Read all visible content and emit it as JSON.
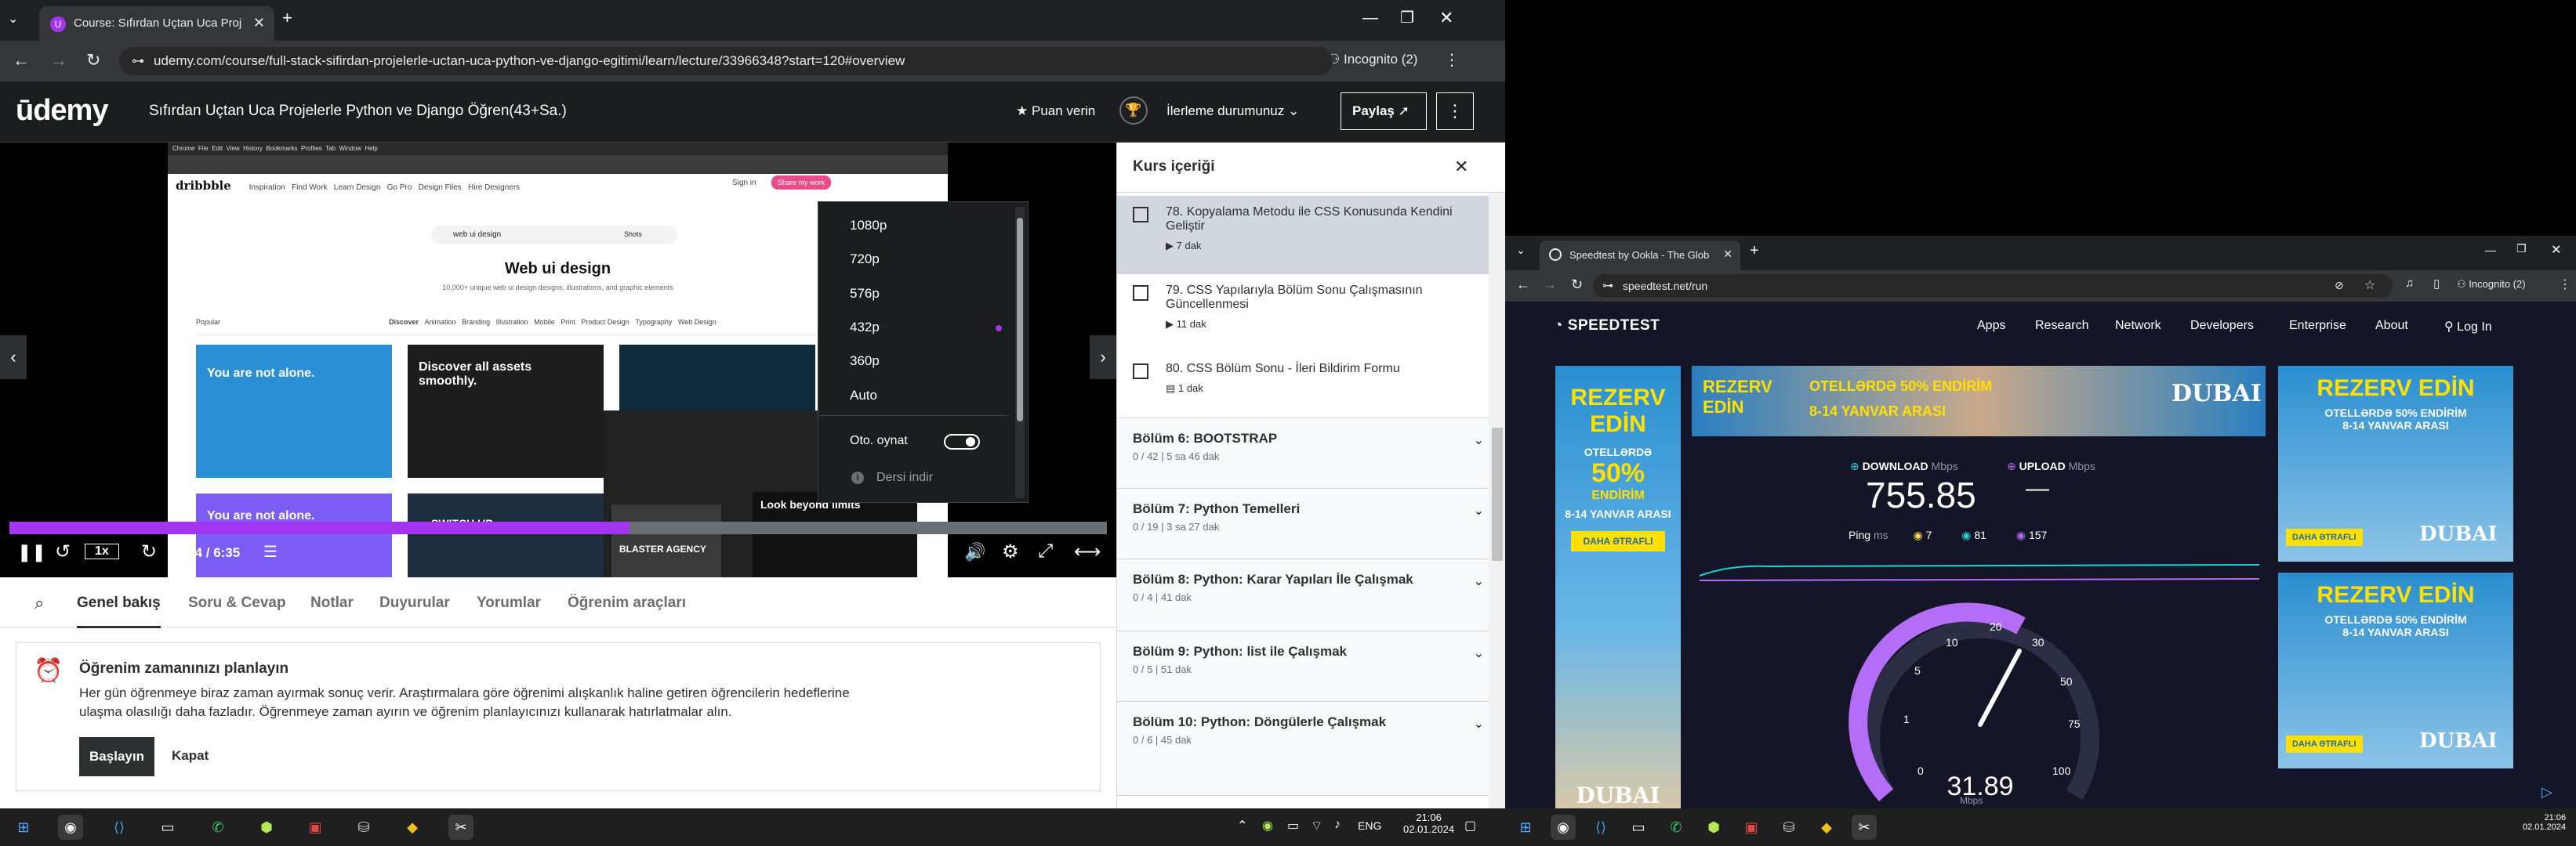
{
  "left_browser": {
    "tab_title": "Course: Sıfırdan Uçtan Uca Proj",
    "new_tab": "+",
    "url": "udemy.com/course/full-stack-sifirdan-projelerle-uctan-uca-python-ve-django-egitimi/learn/lecture/33966348?start=120#overview",
    "profile": "Incognito (2)"
  },
  "udemy_header": {
    "logo": "ūdemy",
    "course_title": "Sıfırdan Uçtan Uca Projelerle Python ve Django Öğren(43+Sa.)",
    "rate": "Puan verin",
    "progress": "İlerleme durumunuz",
    "share": "Paylaş"
  },
  "video_content": {
    "browser_menu": [
      "Chrome",
      "File",
      "Edit",
      "View",
      "History",
      "Bookmarks",
      "Profiles",
      "Tab",
      "Window",
      "Help"
    ],
    "site_logo": "dribbble",
    "site_nav": [
      "Inspiration",
      "Find Work",
      "Learn Design",
      "Go Pro",
      "Design Files",
      "Hire Designers"
    ],
    "sign_in": "Sign in",
    "share_work": "Share my work",
    "search_value": "web ui design",
    "search_scope": "Shots",
    "heading": "Web ui design",
    "subheading": "10,000+ unique web ui design designs, illustrations, and graphic elements",
    "filter_left": "Popular",
    "filter_tabs": [
      "Discover",
      "Animation",
      "Branding",
      "Illustration",
      "Mobile",
      "Print",
      "Product Design",
      "Typography",
      "Web Design"
    ],
    "card_texts": [
      "You are not alone.",
      "Discover all assets smoothly.",
      "Look beyond limits",
      "BLASTER AGENCY",
      "SWITCH UP"
    ]
  },
  "quality_menu": {
    "options": [
      "1080p",
      "720p",
      "576p",
      "432p",
      "360p",
      "Auto"
    ],
    "selected": "432p",
    "autoplay_label": "Oto. oynat",
    "download_label": "Dersi indir"
  },
  "player": {
    "progress": 0.565,
    "speed": "1x",
    "time": "3:54 / 6:35"
  },
  "tabs": [
    "Genel bakış",
    "Soru & Cevap",
    "Notlar",
    "Duyurular",
    "Yorumlar",
    "Öğrenim araçları"
  ],
  "active_tab": "Genel bakış",
  "plan": {
    "title": "Öğrenim zamanınızı planlayın",
    "body": "Her gün öğrenmeye biraz zaman ayırmak sonuç verir. Araştırmalara göre öğrenimi alışkanlık haline getiren öğrencilerin hedeflerine ulaşma olasılığı daha fazladır. Öğrenmeye zaman ayırın ve öğrenim planlayıcınızı kullanarak hatırlatmalar alın.",
    "start": "Başlayın",
    "close": "Kapat"
  },
  "sidebar": {
    "title": "Kurs içeriği",
    "lectures": [
      {
        "title": "78. Kopyalama Metodu ile CSS Konusunda Kendini Geliştir",
        "duration": "7 dak"
      },
      {
        "title": "79. CSS Yapılarıyla Bölüm Sonu Çalışmasının Güncellenmesi",
        "duration": "11 dak"
      },
      {
        "title": "80. CSS Bölüm Sonu - İleri Bildirim Formu",
        "duration": "1 dak"
      }
    ],
    "sections": [
      {
        "title": "Bölüm 6: BOOTSTRAP",
        "sub": "0 / 42 | 5 sa 46 dak"
      },
      {
        "title": "Bölüm 7: Python Temelleri",
        "sub": "0 / 19 | 3 sa 27 dak"
      },
      {
        "title": "Bölüm 8: Python: Karar Yapıları İle Çalışmak",
        "sub": "0 / 4 | 41 dak"
      },
      {
        "title": "Bölüm 9: Python: list ile Çalışmak",
        "sub": "0 / 5 | 51 dak"
      },
      {
        "title": "Bölüm 10: Python: Döngülerle Çalışmak",
        "sub": "0 / 6 | 45 dak"
      }
    ]
  },
  "right_browser": {
    "tab_title": "Speedtest by Ookla - The Glob",
    "url": "speedtest.net/run",
    "profile": "Incognito (2)"
  },
  "speedtest": {
    "logo": "SPEEDTEST",
    "nav": [
      "Apps",
      "Research",
      "Network",
      "Developers",
      "Enterprise",
      "About"
    ],
    "login": "Log In",
    "download_label": "DOWNLOAD",
    "upload_label": "UPLOAD",
    "unit": "Mbps",
    "download_value": "755.85",
    "upload_value": "—",
    "ping_label": "Ping",
    "ping_unit": "ms",
    "ping_idle": "7",
    "ping_down": "81",
    "ping_up": "157",
    "gauge_ticks": [
      "0",
      "1",
      "5",
      "10",
      "20",
      "30",
      "50",
      "75",
      "100"
    ],
    "gauge_value": "31.89",
    "gauge_unit": "Mbps"
  },
  "ads": {
    "side_line1": "REZERV",
    "side_line2": "EDİN",
    "side_line3": "OTELLƏRDƏ",
    "side_pct": "50%",
    "side_line4": "ENDİRİM",
    "dates": "8-14 YANVAR ARASI",
    "more": "DAHA ƏTRAFLI",
    "brand": "DUBAI",
    "top_edin": "REZERV EDİN",
    "top_pct": "OTELLƏRDƏ 50% ENDİRİM",
    "right_line": "REZERV EDİN"
  },
  "taskbar": {
    "lang": "ENG",
    "time_left": "21:06",
    "date_left": "02.01.2024",
    "time_right": "21:06",
    "date_right": "02.01.2024"
  }
}
